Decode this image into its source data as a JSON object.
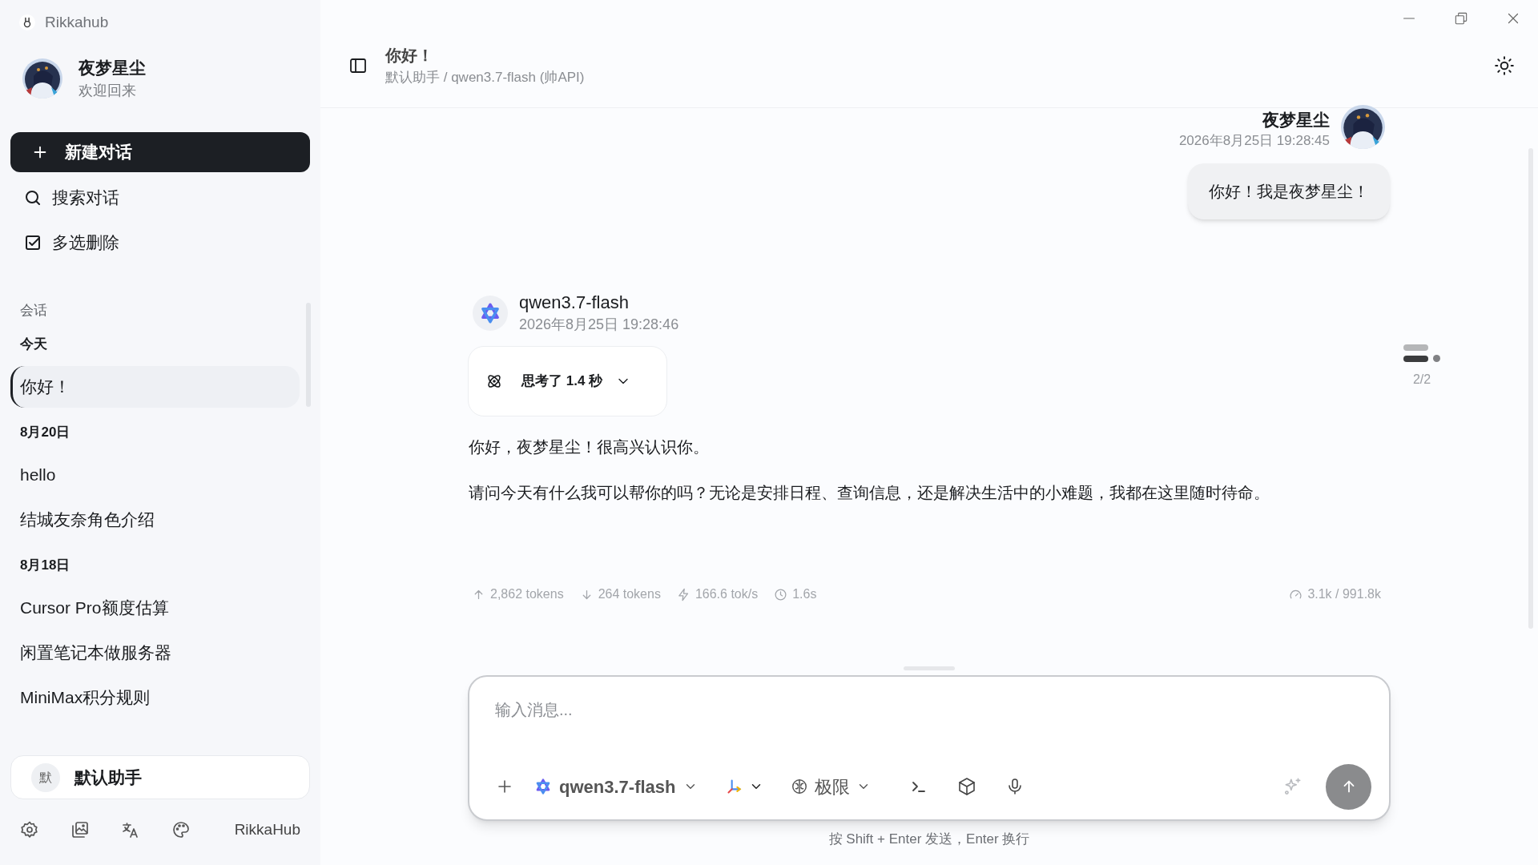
{
  "app": {
    "title": "Rikkahub"
  },
  "profile": {
    "name": "夜梦星尘",
    "subtitle": "欢迎回来"
  },
  "actions": [
    {
      "kind": "primary",
      "label": "新建对话"
    },
    {
      "kind": "search",
      "label": "搜索对话"
    },
    {
      "kind": "multiselect",
      "label": "多选删除"
    }
  ],
  "conversations": {
    "heading": "会话",
    "groups": [
      {
        "label": "今天",
        "items": [
          {
            "title": "你好！",
            "selected": true
          }
        ]
      },
      {
        "label": "8月20日",
        "items": [
          {
            "title": "hello",
            "selected": false
          },
          {
            "title": "结城友奈角色介绍",
            "selected": false
          }
        ]
      },
      {
        "label": "8月18日",
        "items": [
          {
            "title": "Cursor Pro额度估算",
            "selected": false
          },
          {
            "title": "闲置笔记本做服务器",
            "selected": false
          },
          {
            "title": "MiniMax积分规则",
            "selected": false
          }
        ]
      }
    ]
  },
  "assistant_selector": {
    "badge": "默",
    "name": "默认助手"
  },
  "footer": {
    "brand": "RikkaHub"
  },
  "header": {
    "title": "你好！",
    "subtitle": "默认助手 / qwen3.7-flash (帅API)"
  },
  "messages": [
    {
      "kind": "user",
      "author": "夜梦星尘",
      "time": "2026年8月25日 19:28:45",
      "text": "你好！我是夜梦星尘！"
    },
    {
      "kind": "assistant",
      "author": "qwen3.7-flash",
      "time": "2026年8月25日 19:28:46",
      "thinking": {
        "label": "思考了 1.4 秒",
        "expanded": false
      },
      "paragraphs": [
        "你好，夜梦星尘！很高兴认识你。",
        "请问今天有什么我可以帮你的吗？无论是安排日程、查询信息，还是解决生活中的小难题，我都在这里随时待命。"
      ],
      "stats": [
        {
          "kind": "up",
          "text": "2,862 tokens"
        },
        {
          "kind": "down",
          "text": "264 tokens"
        },
        {
          "kind": "speed",
          "text": "166.6 tok/s"
        },
        {
          "kind": "time",
          "text": "1.6s"
        }
      ],
      "context": "3.1k / 991.8k",
      "pager": "2/2"
    }
  ],
  "composer": {
    "placeholder": "输入消息...",
    "model": "qwen3.7-flash",
    "reasoning": "极限",
    "hint": "按 Shift + Enter 发送，Enter 换行"
  }
}
